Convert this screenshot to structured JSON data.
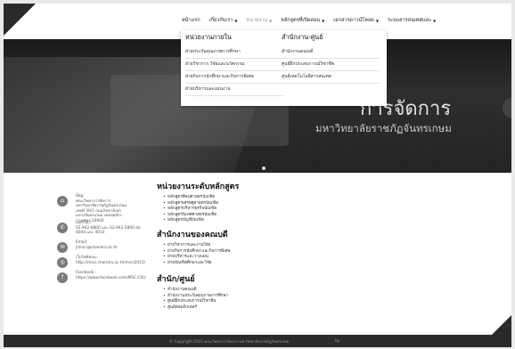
{
  "nav": {
    "items": [
      {
        "label": "หน้าแรก",
        "caret": false,
        "active": false
      },
      {
        "label": "เกี่ยวกับเรา",
        "caret": true,
        "active": false
      },
      {
        "label": "หน่วยงาน",
        "caret": true,
        "active": true
      },
      {
        "label": "หลักสูตรที่เปิดสอน",
        "caret": true,
        "active": false
      },
      {
        "label": "เอกสารดาวน์โหลด",
        "caret": true,
        "active": false
      },
      {
        "label": "ระบบสารสนเทศและ",
        "caret": true,
        "active": false
      }
    ]
  },
  "dropdown": {
    "left_heading": "หน่วยงานภายใน",
    "left_items": [
      "ฝ่ายประกันคุณภาพการศึกษา",
      "ฝ่ายวิชาการ วิจัยและนวัตกรรม",
      "ฝ่ายกิจการนักศึกษาและกิจการพิเศษ",
      "ฝ่ายบริหารและแผนงาน"
    ],
    "right_heading": "สำนักงาน-ศูนย์",
    "right_items": [
      "สำนักงานคณบดี",
      "ศูนย์ฝึกประสบการณ์วิชาชีพ",
      "ศูนย์เทคโนโลยีสารสนเทศ"
    ]
  },
  "hero": {
    "title": "การจัดการ",
    "subtitle": "มหาวิทยาลัยราชภัฏจันทรเกษม"
  },
  "contact": {
    "address_lines": [
      "ที่อยู่:",
      "คณะวิทยาการจัดการ",
      "มหาวิทยาลัยราชภัฏจันทรเกษม",
      "เลขที่ 39/1 ถนนรัชดาภิเษก",
      "แขวงจันทรเกษม เขตจตุจักร",
      "กรุงเทพฯ 10900"
    ],
    "phone_lines": [
      "เบอร์โทร:",
      "02-942-6800 และ 02-942-5800 ต่อ",
      "4004 และ 4013"
    ],
    "email_lines": [
      "Email:",
      "jrmsci@chandra.ac.th"
    ],
    "website_lines": [
      "เว็บไซต์คณะ:",
      "http://msci.chandra.ac.th/msci2015/"
    ],
    "facebook_lines": [
      "Facebook :",
      "https://www.facebook.com/MSC.CRU"
    ]
  },
  "sections": {
    "programs": {
      "title": "หน่วยงานระดับหลักสูตร",
      "items": [
        "หลักสูตรศิลปศาสตรบัณฑิต",
        "หลักสูตรเศรษฐศาสตรบัณฑิต",
        "หลักสูตรบริหารธุรกิจบัณฑิต",
        "หลักสูตรนิเทศศาสตรบัณฑิต",
        "หลักสูตรบัญชีบัณฑิต"
      ]
    },
    "dean_office": {
      "title": "สำนักงานของคณบดี",
      "items": [
        "ฝ่ายวิชาการและงานวิจัย",
        "ฝ่ายกิจการนักศึกษาและกิจการพิเศษ",
        "ฝ่ายบริหารและวางแผน",
        "ฝ่ายบัณฑิตศึกษาและวิจัย"
      ]
    },
    "centers": {
      "title": "สำนัก/ศูนย์",
      "items": [
        "สำนักงานคณบดี",
        "สำนักงานประกันคุณภาพการศึกษา",
        "ศูนย์ฝึกประสบการณ์วิชาชีพ",
        "ศูนย์คอมพิวเตอร์"
      ]
    }
  },
  "footer": {
    "copyright": "© Copyright 2021 คณะวิทยาการจัดการ มหาวิทยาลัยราชภัฏจันทรเกษม",
    "by": "by"
  }
}
